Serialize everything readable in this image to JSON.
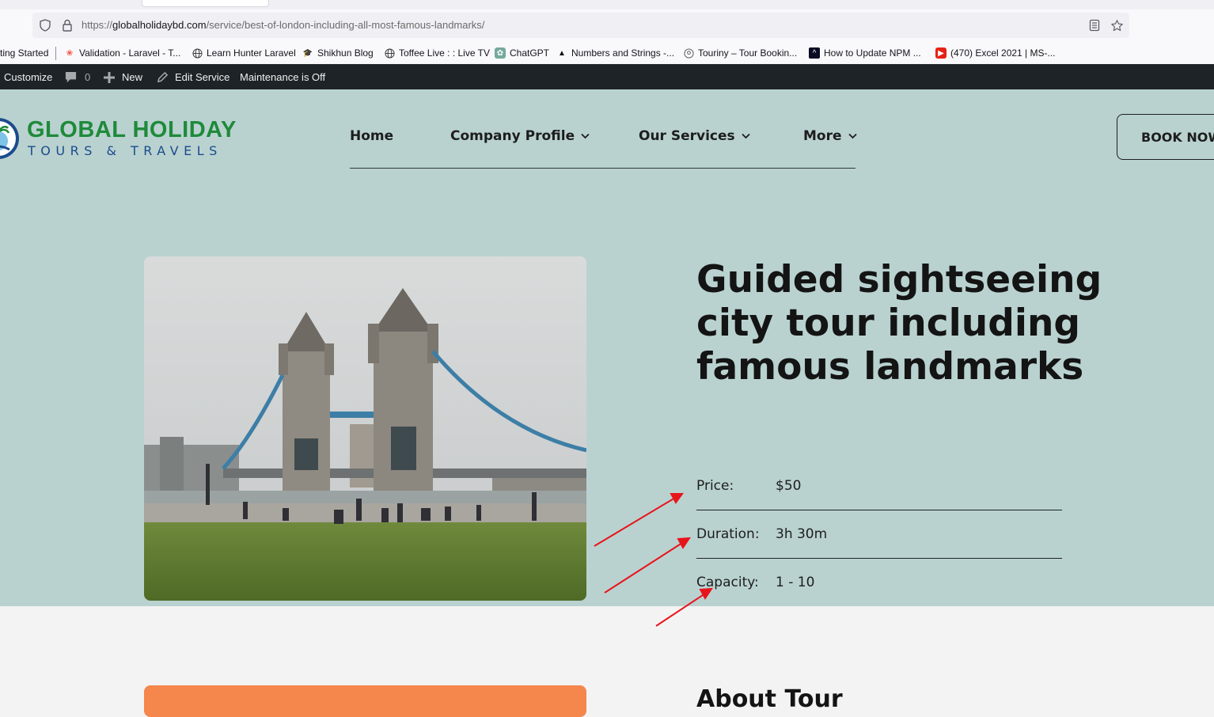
{
  "browser": {
    "url_prefix": "https://",
    "url_host": "globalholidaybd.com",
    "url_path": "/service/best-of-london-including-all-most-famous-landmarks/",
    "bookmarks": [
      {
        "label": "ting Started",
        "icon": "none"
      },
      {
        "label": "Validation - Laravel - T...",
        "icon": "laravel-icon"
      },
      {
        "label": "Learn Hunter Laravel",
        "icon": "globe-icon"
      },
      {
        "label": "Shikhun Blog",
        "icon": "graduation-cap-icon"
      },
      {
        "label": "Toffee Live : : Live TV",
        "icon": "globe-icon"
      },
      {
        "label": "ChatGPT",
        "icon": "chatgpt-icon"
      },
      {
        "label": "Numbers and Strings -...",
        "icon": "hat-icon"
      },
      {
        "label": "Touriny – Tour Bookin...",
        "icon": "location-icon"
      },
      {
        "label": "How to Update NPM ...",
        "icon": "freecodecamp-icon"
      },
      {
        "label": "(470) Excel 2021 | MS-...",
        "icon": "youtube-icon"
      }
    ]
  },
  "adminbar": {
    "customize": "Customize",
    "comments_count": "0",
    "new_label": "New",
    "edit_label": "Edit Service",
    "maintenance": "Maintenance is Off"
  },
  "site": {
    "logo_line1": "GLOBAL HOLIDAY",
    "logo_line2": "TOURS & TRAVELS",
    "nav": [
      "Home",
      "Company Profile",
      "Our Services",
      "More"
    ],
    "book_now": "BOOK NOW"
  },
  "tour": {
    "title": "Guided sightseeing city tour including famous landmarks",
    "details": [
      {
        "label": "Price:",
        "value": "$50"
      },
      {
        "label": "Duration:",
        "value": "3h 30m"
      },
      {
        "label": "Capacity:",
        "value": "1 - 10"
      }
    ],
    "about_heading": "About Tour"
  },
  "colors": {
    "hero_bg": "#b9d2d0",
    "admin_bar": "#1d2327",
    "logo_green": "#1f8a3a",
    "logo_blue": "#1b4b8c",
    "annotation_arrow": "#e8141b",
    "card_orange": "#f5864c"
  }
}
